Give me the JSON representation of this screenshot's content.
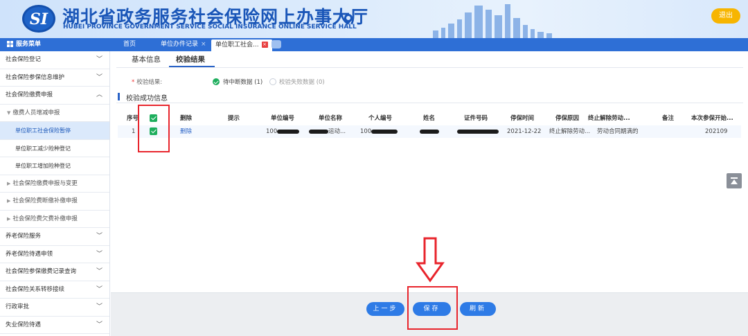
{
  "header": {
    "logo_text": "SI",
    "title": "湖北省政务服务社会保险网上办事大厅",
    "subtitle": "HUBEI PROVINCE GOVERNMENT SERVICE SOCIAL INSURANCE ONLINE SERVICE HALL",
    "logout": "退出"
  },
  "nav": {
    "menu_title": "服务菜单",
    "tabs": [
      {
        "label": "首页"
      },
      {
        "label": "单位办件记录",
        "close": "×"
      },
      {
        "label": "单位职工社会...",
        "close": "×"
      }
    ]
  },
  "sidebar": {
    "items": [
      {
        "label": "社会保险登记",
        "caret": "﹀"
      },
      {
        "label": "社会保险参保信息维护",
        "caret": "﹀"
      },
      {
        "label": "社会保险缴费申报",
        "caret": "︿"
      },
      {
        "label": "缴费人员增减申报"
      },
      {
        "label": "单位职工社会保险暂停"
      },
      {
        "label": "单位职工减少险种登记"
      },
      {
        "label": "单位职工增加险种登记"
      },
      {
        "label": "社会保险缴费申报与变更"
      },
      {
        "label": "社会保险费断缴补缴申报"
      },
      {
        "label": "社会保险费欠费补缴申报"
      },
      {
        "label": "养老保险服务",
        "caret": "﹀"
      },
      {
        "label": "养老保险待遇申领",
        "caret": "﹀"
      },
      {
        "label": "社会保险参保缴费记录查询",
        "caret": "﹀"
      },
      {
        "label": "社会保险关系转移接续",
        "caret": "﹀"
      },
      {
        "label": "行政审批",
        "caret": "﹀"
      },
      {
        "label": "失业保险待遇",
        "caret": "﹀"
      }
    ]
  },
  "main": {
    "subtabs": [
      {
        "label": "基本信息"
      },
      {
        "label": "校验结果"
      }
    ],
    "result_label": "校验结果:",
    "options": [
      {
        "label": "待中断数据 (1)"
      },
      {
        "label": "校验失败数据 (0)"
      }
    ],
    "section_title": "校验成功信息",
    "table": {
      "headers": [
        "序号",
        "删除",
        "提示",
        "单位编号",
        "单位名称",
        "个人编号",
        "姓名",
        "证件号码",
        "停保时间",
        "停保原因",
        "终止解除劳动...",
        "备注",
        "本次参保开始..."
      ],
      "rows": [
        {
          "index": "1",
          "delete": "删除",
          "hint": "",
          "unit_no": "100",
          "unit_name": "运动...",
          "person_no": "100",
          "name": "",
          "id_no": "",
          "stop_date": "2021-12-22",
          "stop_reason": "终止解除劳动...",
          "terminate": "劳动合同期满的",
          "remark": "",
          "start": "202109"
        }
      ]
    }
  },
  "footer": {
    "prev": "上一步",
    "save": "保存",
    "refresh": "刷新"
  },
  "colors": {
    "brand_blue": "#2e6fd6",
    "checkbox_green": "#1eae5d",
    "annotation_red": "#e8242c",
    "logout_yellow": "#f7b500"
  }
}
